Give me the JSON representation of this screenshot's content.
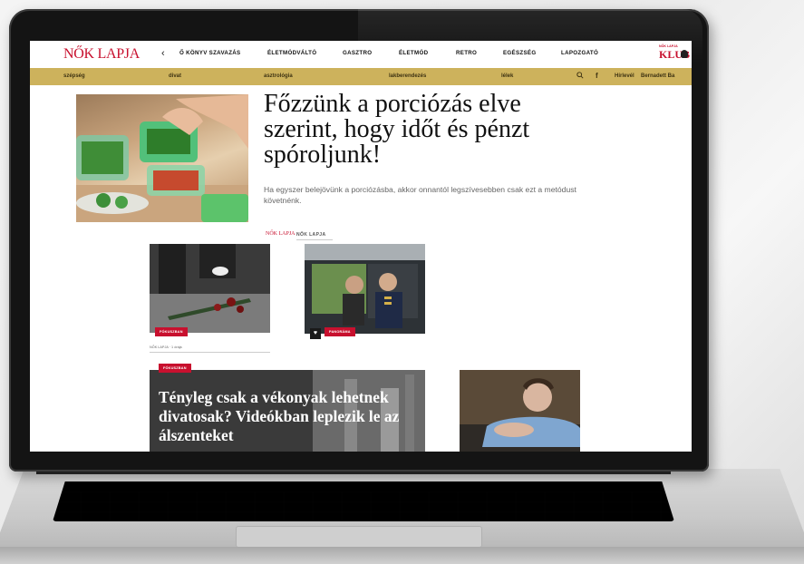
{
  "site": {
    "logo": "NŐK LAPJA",
    "nav_arrow": "‹",
    "nav_items": [
      "Ő KÖNYV SZAVAZÁS",
      "ÉLETMÓDVÁLTÓ",
      "GASZTRO",
      "ÉLETMÓD",
      "RETRO",
      "EGÉSZSÉG",
      "LAPOZGATÓ"
    ],
    "klub_small": "NŐK LAPJA",
    "klub_label": "KLUB",
    "subnav_items": [
      "szépség",
      "divat",
      "asztrológia",
      "lakberendezés",
      "lélek"
    ],
    "subnav_right": [
      "Hírlevél",
      "Bernadett Ba"
    ],
    "icons": [
      "search-icon",
      "facebook-icon"
    ],
    "accent_color": "#c8102e",
    "subnav_color": "#cdb25c"
  },
  "hero": {
    "title": "Főzzünk a porciózás elve szerint, hogy időt és pénzt spóroljunk!",
    "lead": "Ha egyszer belejövünk a porciózásba, akkor onnantól legszívesebben csak ezt a metódust követnénk."
  },
  "brand_row": {
    "logo": "NŐK LAPJA",
    "name": "NŐK LAPJA"
  },
  "cards": [
    {
      "tag": "FÓKUSZBAN",
      "meta": "NŐK LAPJA · 1 órája"
    },
    {
      "tag": "PANORÁMA"
    }
  ],
  "big_card": {
    "tag": "FÓKUSZBAN",
    "title": "Tényleg csak a vékonyak lehetnek divatosak? Videókban leplezik le az álszenteket"
  }
}
